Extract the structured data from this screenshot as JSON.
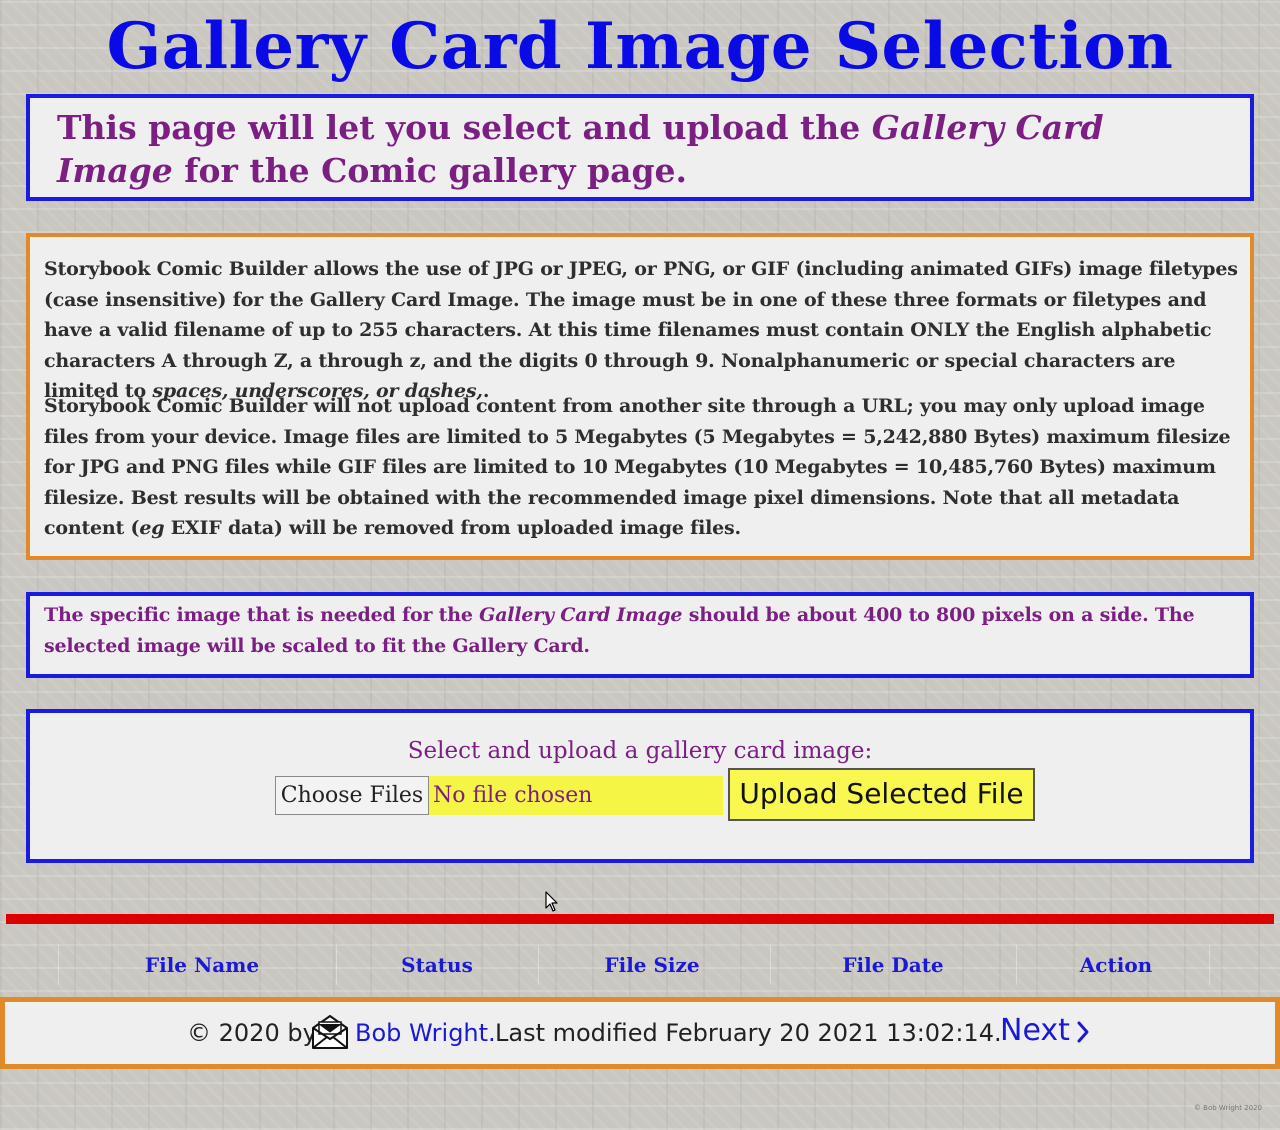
{
  "page": {
    "title": "Gallery Card Image Selection"
  },
  "intro": {
    "text_before": "This page will let you select and upload the ",
    "text_em": "Gallery Card Image",
    "text_after": " for the Comic gallery page."
  },
  "info": {
    "p1_main": "Storybook Comic Builder allows the use of JPG or JPEG, or PNG, or GIF (including animated GIFs) image filetypes (case insensitive) for the Gallery Card Image. The image must be in one of these three formats or filetypes and have a valid filename of up to 255 characters. At this time filenames must contain ONLY the English alphabetic characters A through Z, a through z, and the digits 0 through 9. Nonalphanumeric or special characters are limited to ",
    "p1_em": "spaces, underscores, or dashes,",
    "p1_end": ".",
    "p2_before": "Storybook Comic Builder will not upload content from another site through a URL; you may only upload image files from your device. Image files are limited to 5 Megabytes (5 Megabytes = 5,242,880 Bytes) maximum filesize for JPG and PNG files while GIF files are limited to 10 Megabytes (10 Megabytes = 10,485,760 Bytes) maximum filesize. Best results will be obtained with the recommended image pixel dimensions. Note that all metadata content (",
    "p2_em": "eg",
    "p2_after": " EXIF data) will be removed from uploaded image files."
  },
  "spec": {
    "text_before": "The specific image that is needed for the ",
    "text_em": "Gallery Card Image",
    "text_after": " should be about 400 to 800 pixels on a side. The selected image will be scaled to fit the Gallery Card."
  },
  "upload": {
    "label": "Select and upload a gallery card image:",
    "choose_label": "Choose Files",
    "file_status": "No file chosen",
    "upload_label": "Upload Selected File"
  },
  "table": {
    "headers": [
      "File Name",
      "Status",
      "File Size",
      "File Date",
      "Action"
    ]
  },
  "footer": {
    "copyright": "© 2020 by",
    "author_link": "Bob Wright.",
    "modified": "Last modified February 20 2021 13:02:14.",
    "next_label": "Next",
    "corner_mark": "© Bob Wright 2020"
  },
  "colors": {
    "title": "#0a0ae6",
    "purple_text": "#7b1f83",
    "blue_border": "#1a1ae0",
    "orange_border": "#e08a2a",
    "divider_red": "#dd0000",
    "upload_yellow": "#f8f850",
    "link_blue": "#1a1ad6"
  },
  "icons": {
    "mail": "envelope-icon",
    "next": "chevron-right-icon",
    "cursor": "mouse-pointer-icon"
  }
}
